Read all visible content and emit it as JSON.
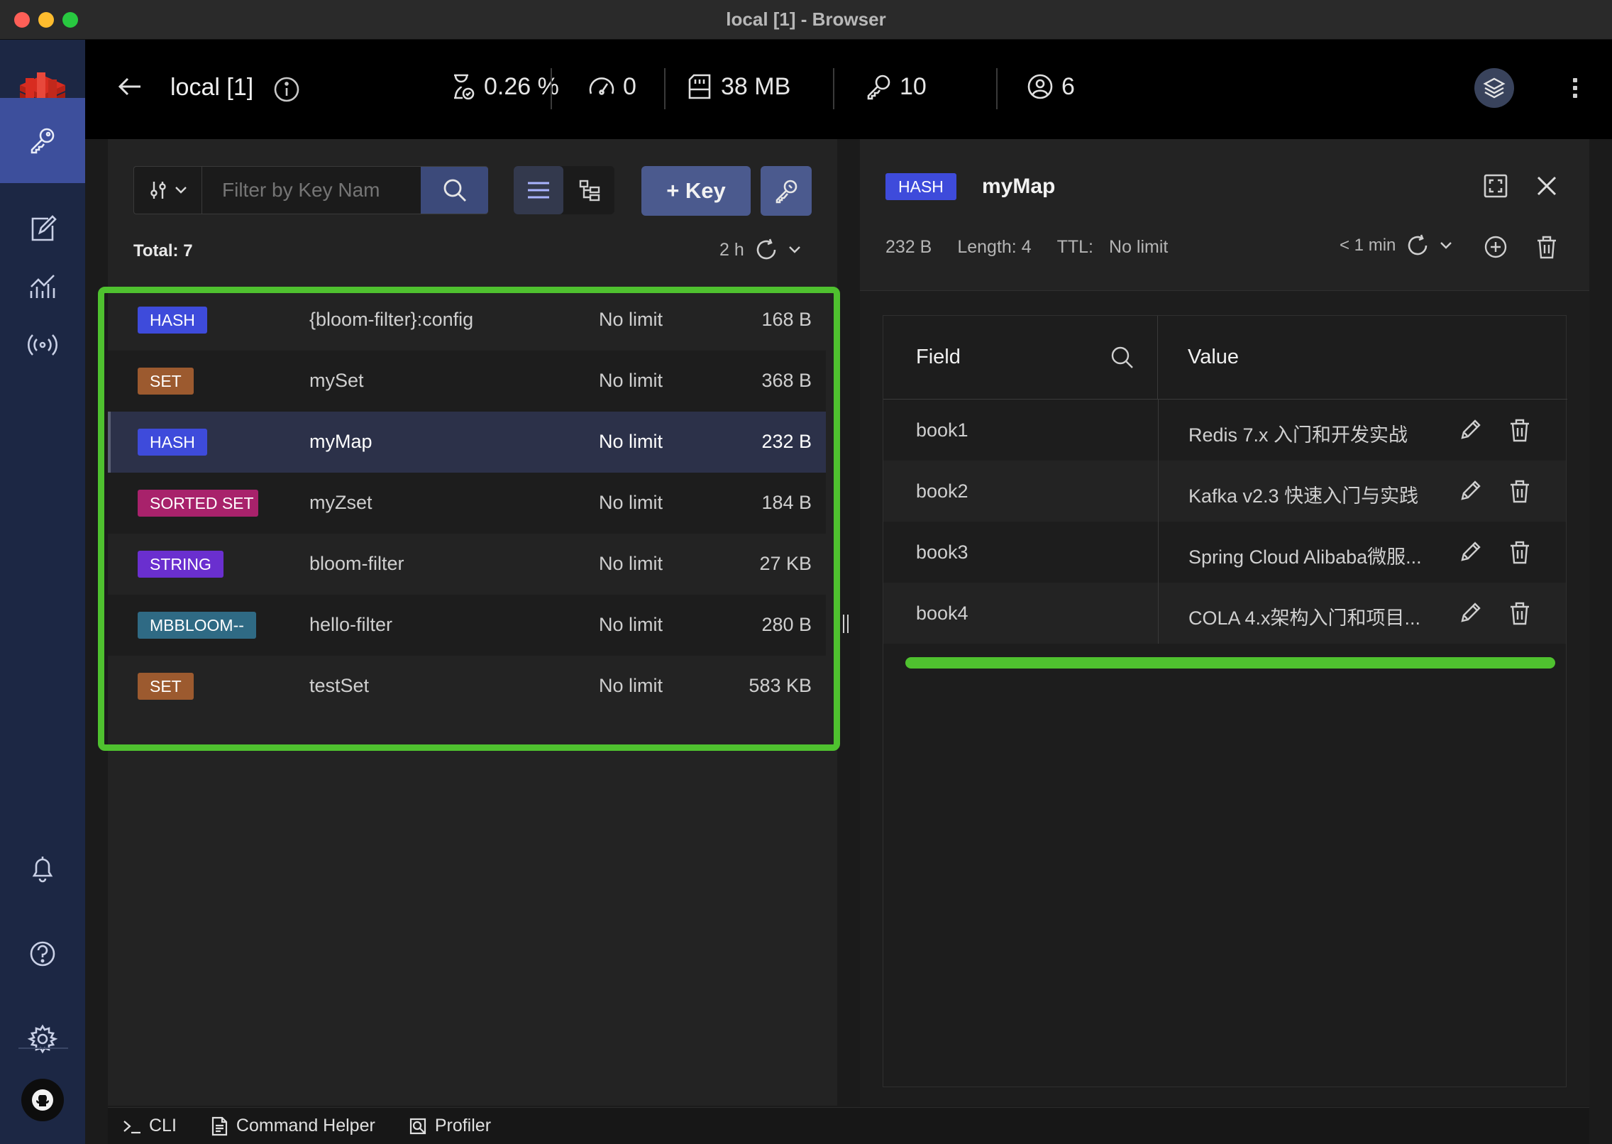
{
  "window": {
    "title": "local [1] - Browser"
  },
  "header": {
    "db_name": "local [1]",
    "stats": {
      "cpu": "0.26 %",
      "ops": "0",
      "memory": "38 MB",
      "keys": "10",
      "clients": "6"
    }
  },
  "browser": {
    "filter_placeholder": "Filter by Key Nam",
    "add_key_label": "+ Key",
    "total": "Total: 7",
    "last_refresh": "2 h",
    "keys": [
      {
        "type": "HASH",
        "type_color": "#3e4bdb",
        "name": "{bloom-filter}:config",
        "ttl": "No limit",
        "size": "168 B"
      },
      {
        "type": "SET",
        "type_color": "#9c5a2f",
        "name": "mySet",
        "ttl": "No limit",
        "size": "368 B"
      },
      {
        "type": "HASH",
        "type_color": "#3e4bdb",
        "name": "myMap",
        "ttl": "No limit",
        "size": "232 B",
        "selected": true
      },
      {
        "type": "SORTED SET",
        "type_color": "#a8226b",
        "name": "myZset",
        "ttl": "No limit",
        "size": "184 B"
      },
      {
        "type": "STRING",
        "type_color": "#6a2fcf",
        "name": "bloom-filter",
        "ttl": "No limit",
        "size": "27 KB"
      },
      {
        "type": "MBBLOOM--",
        "type_color": "#2f6a84",
        "name": "hello-filter",
        "ttl": "No limit",
        "size": "280 B"
      },
      {
        "type": "SET",
        "type_color": "#9c5a2f",
        "name": "testSet",
        "ttl": "No limit",
        "size": "583 KB"
      }
    ]
  },
  "details": {
    "type": "HASH",
    "key_name": "myMap",
    "size": "232 B",
    "length": "Length: 4",
    "ttl_label": "TTL:",
    "ttl_value": "No limit",
    "last_refresh": "< 1 min",
    "columns": {
      "field": "Field",
      "value": "Value"
    },
    "rows": [
      {
        "field": "book1",
        "value": "Redis 7.x 入门和开发实战"
      },
      {
        "field": "book2",
        "value": "Kafka v2.3 快速入门与实践"
      },
      {
        "field": "book3",
        "value": "Spring Cloud Alibaba微服..."
      },
      {
        "field": "book4",
        "value": "COLA 4.x架构入门和项目..."
      }
    ]
  },
  "bottom_bar": {
    "cli": "CLI",
    "command_helper": "Command Helper",
    "profiler": "Profiler"
  },
  "colors": {
    "accent": "#3d4f9c",
    "highlight": "#4fc12f",
    "sidebar": "#1c2744"
  }
}
